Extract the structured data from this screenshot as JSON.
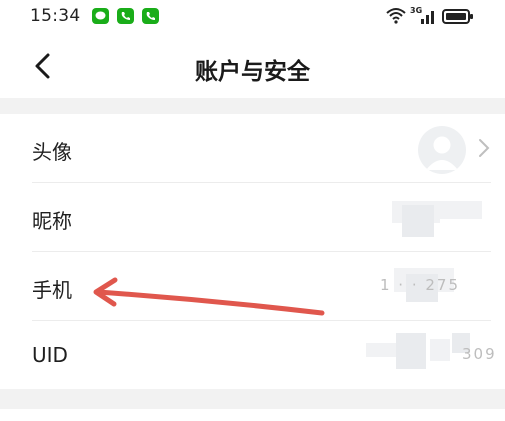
{
  "status_bar": {
    "time": "15:34",
    "apps": [
      "chat-app-icon",
      "phone-app-icon",
      "phone-app-icon"
    ],
    "network_label": "3G"
  },
  "header": {
    "back_icon": "chevron-left-icon",
    "title": "账户与安全"
  },
  "rows": [
    {
      "label": "头像",
      "value": ""
    },
    {
      "label": "昵称",
      "value": ""
    },
    {
      "label": "手机",
      "value": "1 ·  ·      275"
    },
    {
      "label": "UID",
      "value": "309"
    }
  ],
  "colors": {
    "accent_green": "#1aad19",
    "arrow_red": "#e0574d",
    "separator": "#ececec",
    "band": "#f2f2f2"
  }
}
